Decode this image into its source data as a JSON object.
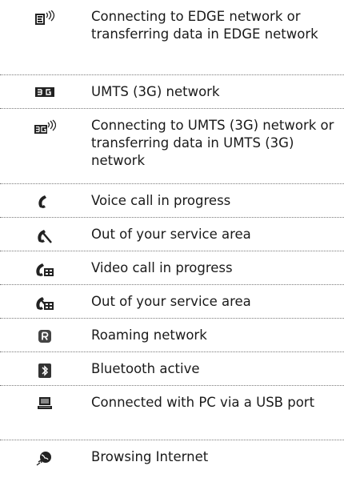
{
  "rows": [
    {
      "icon": "edge-transfer-icon",
      "text": "Connecting to EDGE network or transferring data in EDGE network"
    },
    {
      "icon": "umts-3g-network-icon",
      "text": "UMTS (3G) network"
    },
    {
      "icon": "umts-3g-transfer-icon",
      "text": "Connecting to UMTS (3G) network or transferring data in UMTS (3G) network"
    },
    {
      "icon": "voice-call-icon",
      "text": "Voice call in progress"
    },
    {
      "icon": "voice-out-of-service-icon",
      "text": "Out of your service area"
    },
    {
      "icon": "video-call-icon",
      "text": "Video call in progress"
    },
    {
      "icon": "video-out-of-service-icon",
      "text": "Out of your service area"
    },
    {
      "icon": "roaming-icon",
      "text": "Roaming network"
    },
    {
      "icon": "bluetooth-icon",
      "text": "Bluetooth active"
    },
    {
      "icon": "pc-usb-icon",
      "text": "Connected with PC via a USB port"
    },
    {
      "icon": "browsing-internet-icon",
      "text": "Browsing Internet"
    }
  ]
}
